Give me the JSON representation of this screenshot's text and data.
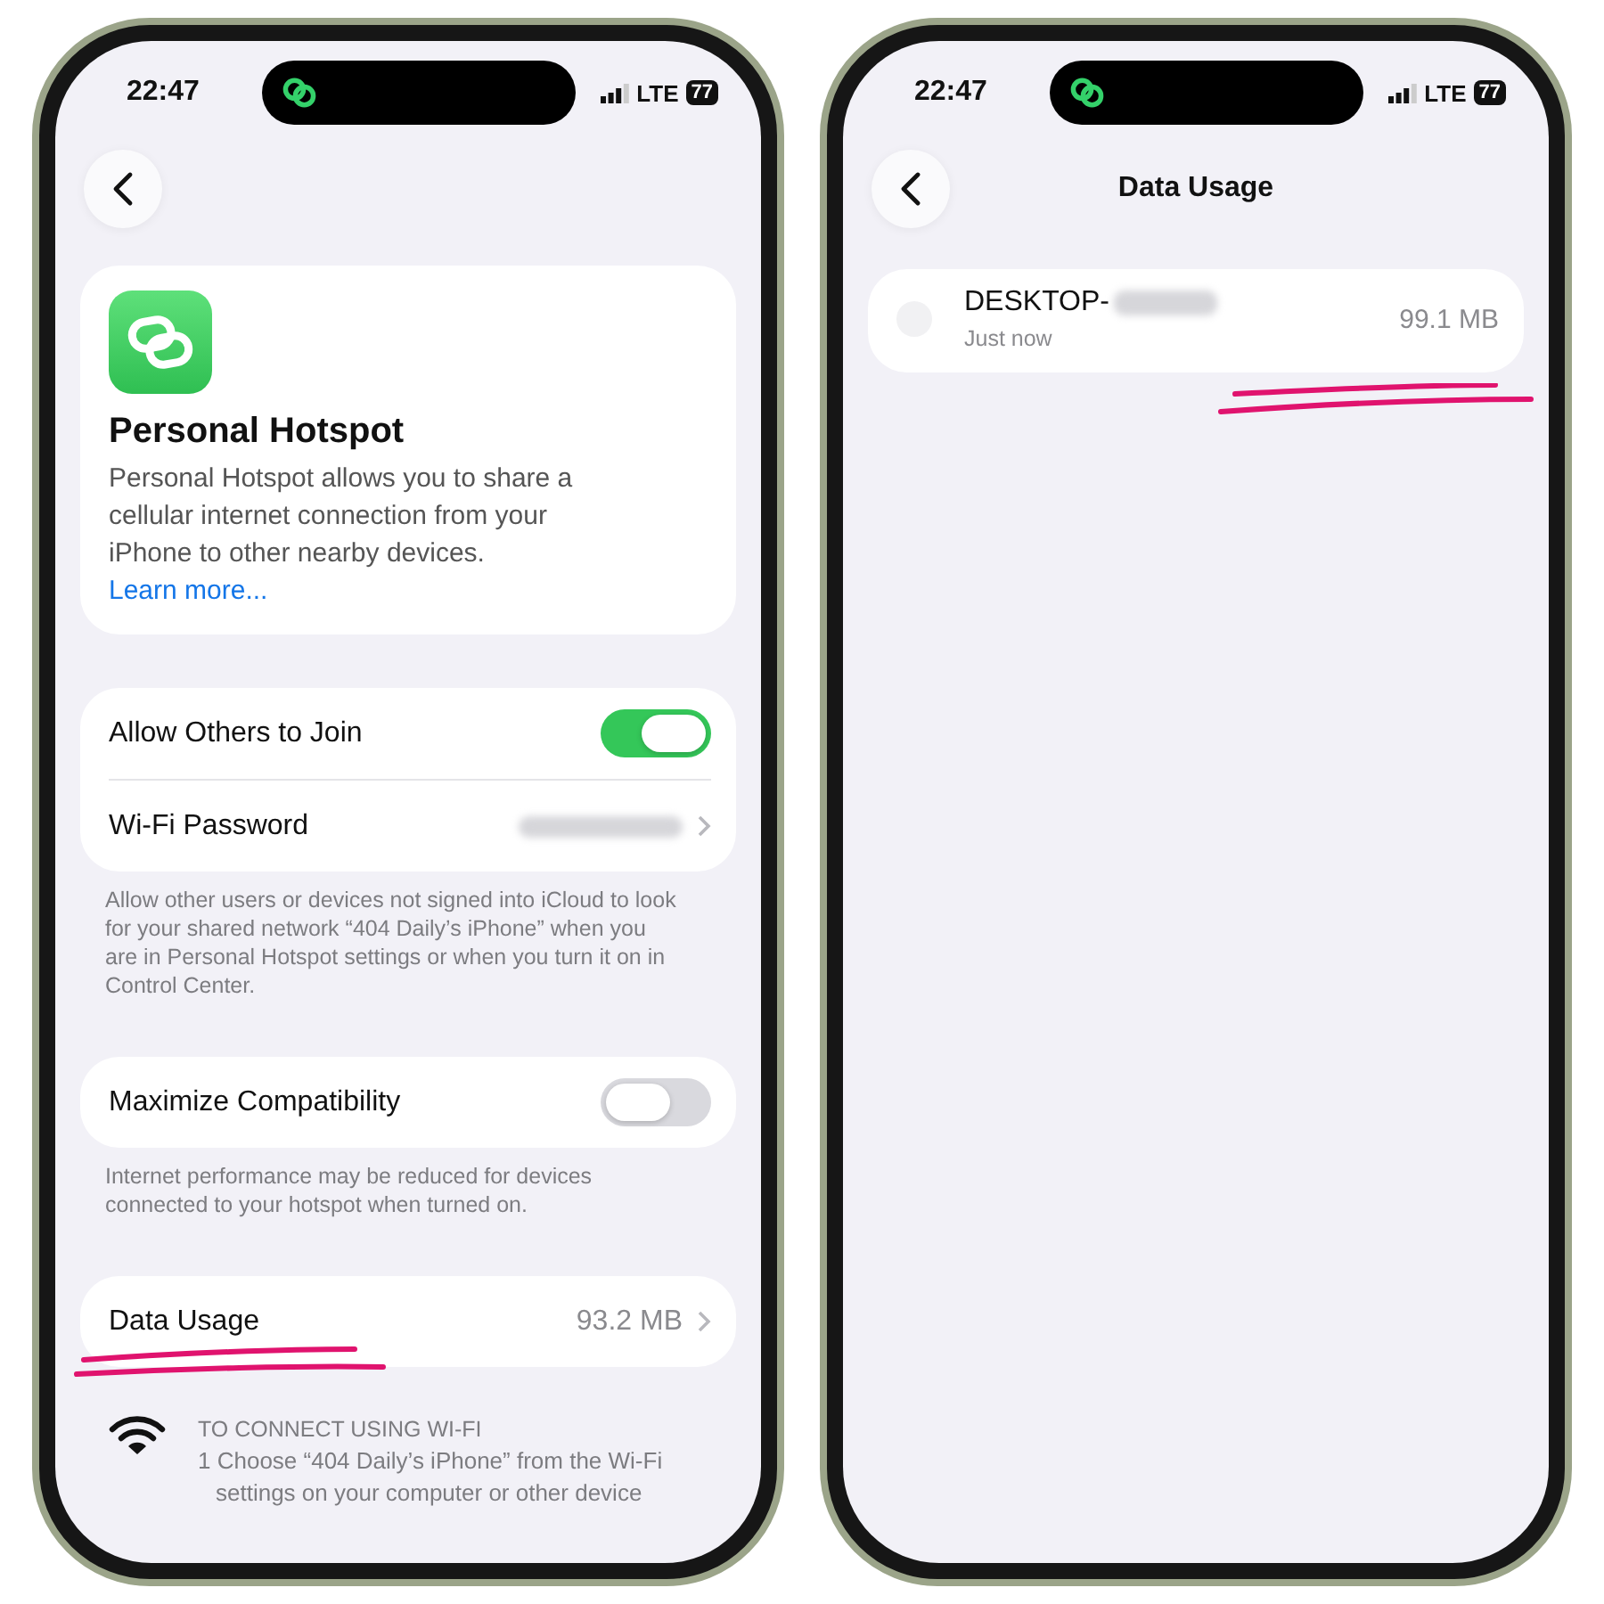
{
  "left_screen": {
    "status": {
      "time": "22:47",
      "network": "LTE",
      "battery": "77"
    },
    "header": {
      "title": "Personal Hotspot",
      "description": "Personal Hotspot allows you to share a cellular internet connection from your iPhone to other nearby devices.",
      "link": "Learn more..."
    },
    "groups": [
      {
        "rows": [
          {
            "kind": "toggle",
            "label": "Allow Others to Join",
            "on": true
          },
          {
            "kind": "hidden",
            "label": "Wi-Fi Password"
          }
        ],
        "footer": "Allow other users or devices not signed into iCloud to look for your shared network “404 Daily’s iPhone” when you are in Personal Hotspot settings or when you turn it on in Control Center."
      },
      {
        "rows": [
          {
            "kind": "toggle",
            "label": "Maximize Compatibility",
            "on": false
          }
        ],
        "footer": "Internet performance may be reduced for devices connected to your hotspot when turned on."
      },
      {
        "rows": [
          {
            "kind": "value",
            "label": "Data Usage",
            "value": "93.2 MB"
          }
        ]
      }
    ],
    "wifi_section": {
      "heading": "TO CONNECT USING WI-FI",
      "lines": [
        "1 Choose “404 Daily’s iPhone” from the Wi-Fi",
        "settings on your computer or other device"
      ]
    }
  },
  "right_screen": {
    "status": {
      "time": "22:47",
      "network": "LTE",
      "battery": "77"
    },
    "title": "Data Usage",
    "devices": [
      {
        "name": "DESKTOP-",
        "time": "Just now",
        "usage": "99.1 MB"
      }
    ]
  }
}
